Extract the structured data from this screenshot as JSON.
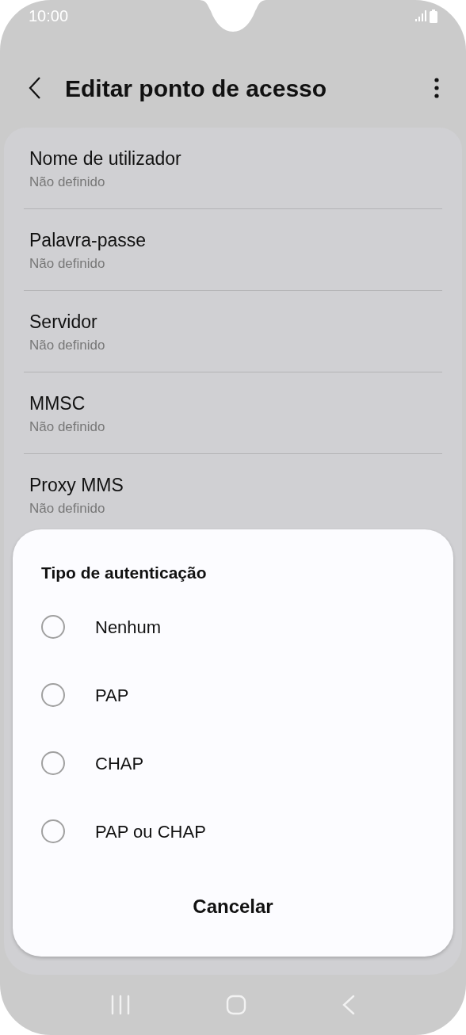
{
  "status_bar": {
    "time": "10:00"
  },
  "header": {
    "title": "Editar ponto de acesso"
  },
  "settings": [
    {
      "title": "Nome de utilizador",
      "value": "Não definido"
    },
    {
      "title": "Palavra-passe",
      "value": "Não definido"
    },
    {
      "title": "Servidor",
      "value": "Não definido"
    },
    {
      "title": "MMSC",
      "value": "Não definido"
    },
    {
      "title": "Proxy MMS",
      "value": "Não definido"
    }
  ],
  "dialog": {
    "title": "Tipo de autenticação",
    "options": [
      {
        "label": "Nenhum",
        "selected": false
      },
      {
        "label": "PAP",
        "selected": false
      },
      {
        "label": "CHAP",
        "selected": false
      },
      {
        "label": "PAP ou CHAP",
        "selected": false
      }
    ],
    "cancel": "Cancelar"
  }
}
